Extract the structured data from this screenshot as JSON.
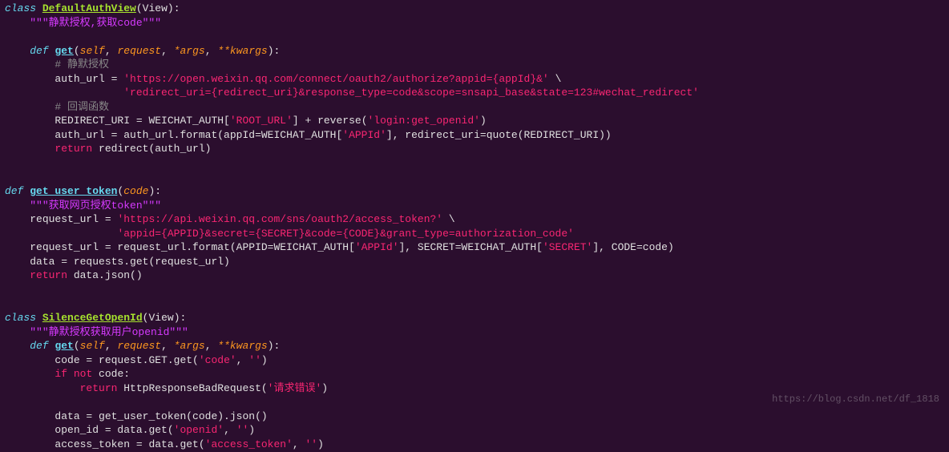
{
  "code": {
    "class1_name": "DefaultAuthView",
    "base1": "View",
    "class1_doc": "\"\"\"静默授权,获取code\"\"\"",
    "def": "def",
    "class": "class",
    "return": "return",
    "if": "if",
    "not": "not",
    "get": "get",
    "self": "self",
    "request": "request",
    "args": "*args",
    "kwargs": "**kwargs",
    "cmt_silent": "# 静默授权",
    "auth_url_var": "auth_url = ",
    "auth_url_str1": "'https://open.weixin.qq.com/connect/oauth2/authorize?appid={appId}&'",
    "auth_url_str2": "'redirect_uri={redirect_uri}&response_type=code&scope=snsapi_base&state=123#wechat_redirect'",
    "cmt_callback": "# 回调函数",
    "redirect_line": "REDIRECT_URI = WEICHAT_AUTH[",
    "root_url": "'ROOT_URL'",
    "reverse_txt": "] + reverse(",
    "login_openid": "'login:get_openid'",
    "close_paren": ")",
    "auth_format": "auth_url = auth_url.format(appId=WEICHAT_AUTH[",
    "appid": "'APPId'",
    "redirect_part": "], redirect_uri=quote(REDIRECT_URI))",
    "return_redirect": " redirect(auth_url)",
    "fn_user_token": "get_user_token",
    "code_param": "code",
    "doc_token": "\"\"\"获取网页授权token\"\"\"",
    "req_url_var": "request_url = ",
    "req_url_str1": "'https://api.weixin.qq.com/sns/oauth2/access_token?'",
    "req_url_str2": "'appid={APPID}&secret={SECRET}&code={CODE}&grant_type=authorization_code'",
    "req_format": "request_url = request_url.format(APPID=WEICHAT_AUTH[",
    "secret_part": "], SECRET=WEICHAT_AUTH[",
    "secret": "'SECRET'",
    "code_part": "], CODE=code)",
    "data_req": "data = requests.get(request_url)",
    "return_json": " data.json()",
    "class2_name": "SilenceGetOpenId",
    "class2_doc": "\"\"\"静默授权获取用户openid\"\"\"",
    "code_get": "code = request.GET.get(",
    "code_str": "'code'",
    "empty_str": "''",
    "close_p2": ")",
    "if_not_code": " code:",
    "return_bad": " HttpResponseBadRequest(",
    "req_err": "'请求错误'",
    "data_token": "data = get_user_token(code).json()",
    "openid_get": "open_id = data.get(",
    "openid_str": "'openid'",
    "access_get": "access_token = data.get(",
    "access_str": "'access_token'"
  },
  "watermark": "https://blog.csdn.net/df_1818"
}
